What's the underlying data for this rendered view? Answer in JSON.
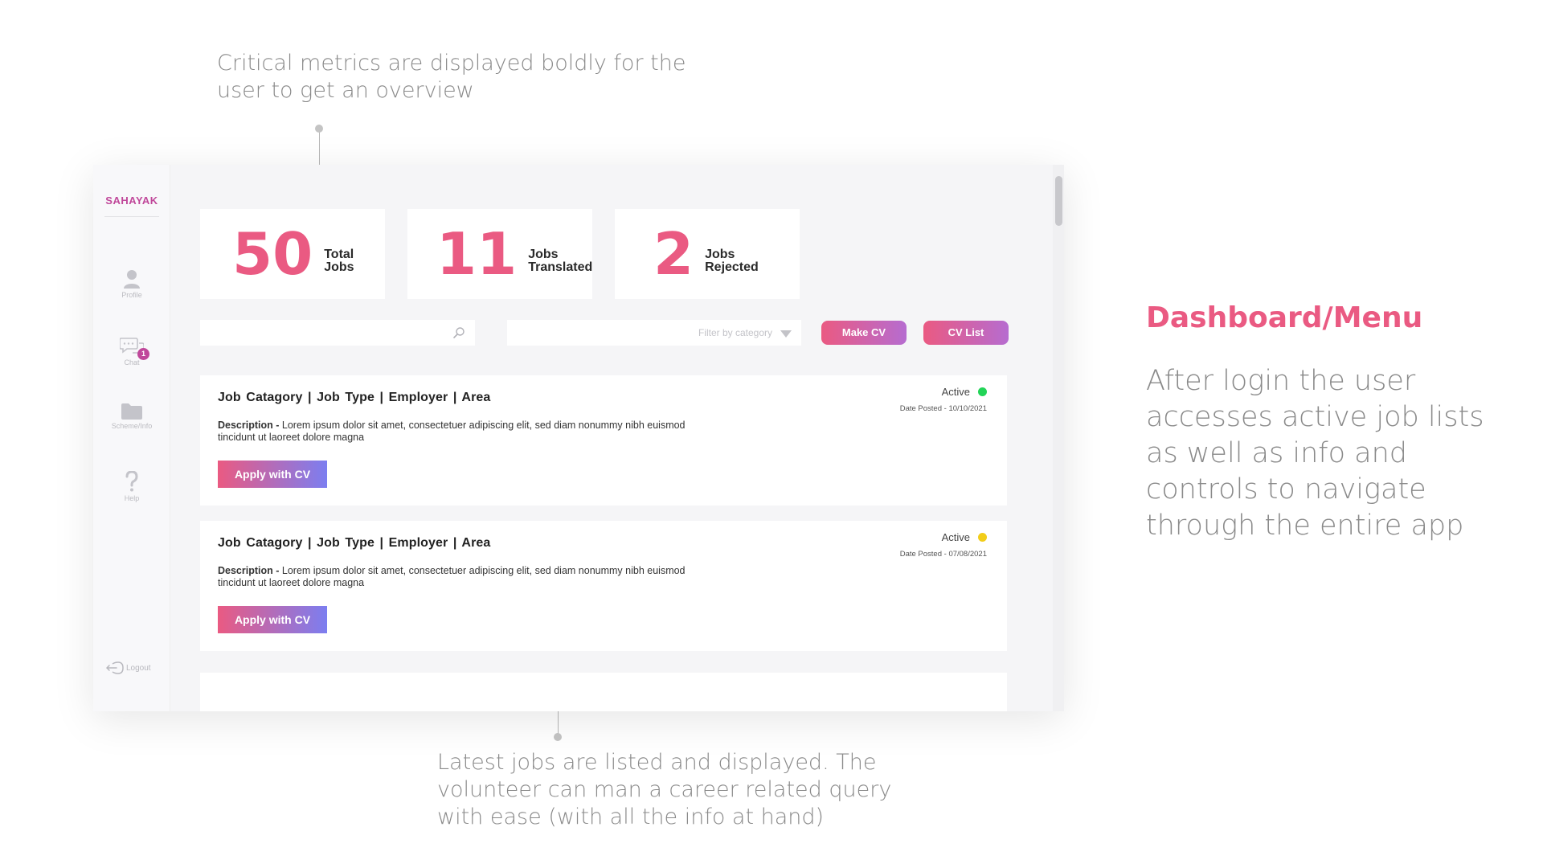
{
  "annotations": {
    "top": "Critical metrics are displayed boldly for the user to get an overview",
    "bottom": "Latest jobs are listed and displayed. The volunteer can man a career related query with ease (with all the info at hand)",
    "side_title": "Dashboard/Menu",
    "side_desc": "After login the user accesses active job lists as well as info and controls to navigate through the entire app"
  },
  "sidebar": {
    "brand": "SAHAYAK",
    "items": [
      {
        "label": "Profile",
        "icon": "user-icon"
      },
      {
        "label": "Chat",
        "icon": "chat-icon",
        "badge": "1"
      },
      {
        "label": "Scheme/Info",
        "icon": "folder-icon"
      },
      {
        "label": "Help",
        "icon": "help-icon"
      }
    ],
    "logout": "Logout"
  },
  "stats": [
    {
      "value": "50",
      "label": "Total\nJobs"
    },
    {
      "value": "11",
      "label": "Jobs\nTranslated"
    },
    {
      "value": "2",
      "label": "Jobs\nRejected"
    }
  ],
  "toolbar": {
    "search_placeholder": "",
    "filter_placeholder": "Filter by category",
    "make_cv": "Make CV",
    "cv_list": "CV List"
  },
  "jobs": [
    {
      "title": "Job Catagory  |  Job Type  |  Employer |  Area",
      "status": "Active",
      "status_color": "#22d457",
      "date": "Date Posted - 10/10/2021",
      "desc_label": "Description - ",
      "desc": "Lorem ipsum dolor sit amet, consectetuer adipiscing elit, sed diam nonummy nibh euismod tincidunt ut laoreet dolore magna",
      "apply": "Apply with CV"
    },
    {
      "title": "Job Catagory  |  Job Type  |  Employer |  Area",
      "status": "Active",
      "status_color": "#f2cd1a",
      "date": "Date Posted - 07/08/2021",
      "desc_label": "Description - ",
      "desc": "Lorem ipsum dolor sit amet, consectetuer adipiscing elit, sed diam nonummy nibh euismod tincidunt ut laoreet dolore magna",
      "apply": "Apply with CV"
    }
  ],
  "colors": {
    "accent": "#ea5a82",
    "brand": "#c0479a"
  }
}
